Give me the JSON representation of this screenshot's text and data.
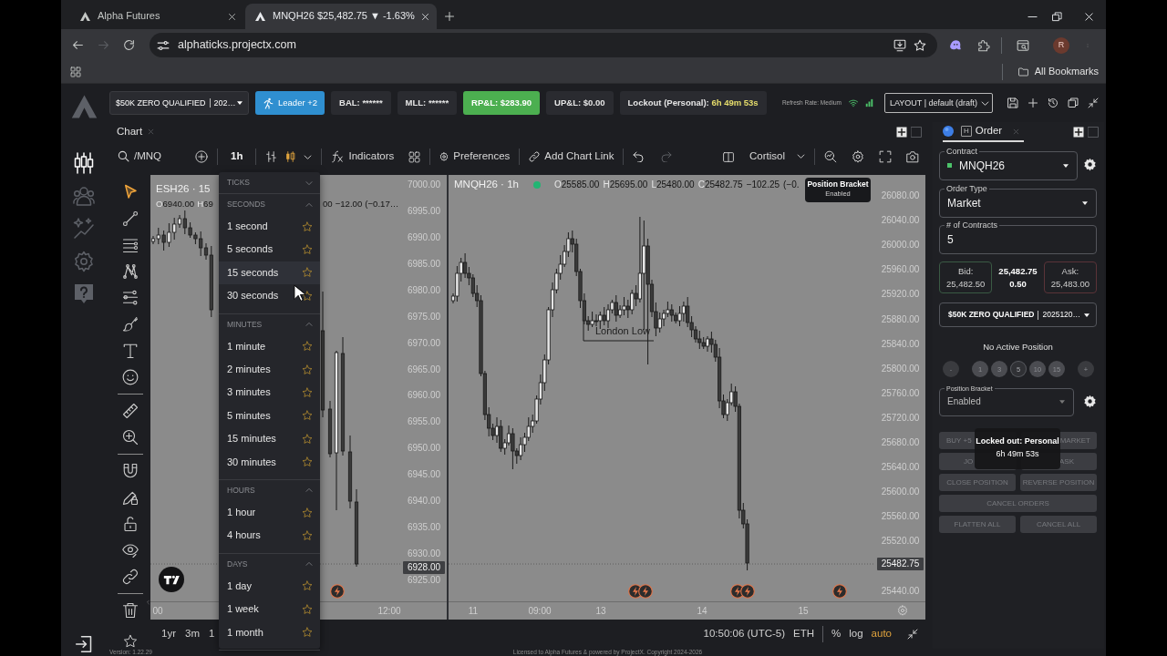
{
  "browser": {
    "tabs": [
      {
        "title": "Alpha Futures",
        "selected": false
      },
      {
        "title": "MNQH26 $25,482.75 ▼ -1.63%",
        "selected": true
      }
    ],
    "url": "alphaticks.projectx.com",
    "profile_initial": "R",
    "bookmarks_folder": "All Bookmarks"
  },
  "header": {
    "account": {
      "name": "$50K ZERO QUALIFIED",
      "number": "202…"
    },
    "leader_button": "Leader +2",
    "stats": [
      {
        "text": "BAL:",
        "value": "******",
        "kind": "plain"
      },
      {
        "text": "MLL:",
        "value": "******",
        "kind": "plain"
      },
      {
        "text": "RP&L:",
        "value": "$283.90",
        "kind": "positive"
      },
      {
        "text": "UP&L:",
        "value": "$0.00",
        "kind": "plain"
      },
      {
        "text": "Lockout (Personal):",
        "value": "6h 49m 53s",
        "kind": "warning"
      }
    ],
    "refresh_rate": "Refresh Rate: Medium",
    "layout": "LAYOUT | default (draft)"
  },
  "nav_rail": [
    {
      "kind": "chart",
      "selected": true
    },
    {
      "kind": "people",
      "selected": false
    },
    {
      "kind": "analytics",
      "selected": false
    },
    {
      "kind": "settings",
      "selected": false
    },
    {
      "kind": "help",
      "selected": false
    }
  ],
  "chart_panel": {
    "tab": "Chart",
    "toolbar": {
      "symbol": "/MNQ",
      "interval": "1h",
      "indicators": "Indicators",
      "preferences": "Preferences",
      "chart_link": "Add Chart Link",
      "undo_disabled": false,
      "redo_disabled": true,
      "template": "Cortisol"
    },
    "drawing_tools": [
      [
        {
          "kind": "cursor",
          "selected": true
        },
        {
          "kind": "trend-line",
          "selected": false
        },
        {
          "kind": "horizontal-lines",
          "selected": false
        },
        {
          "kind": "pattern",
          "selected": false
        },
        {
          "kind": "channel",
          "selected": false
        },
        {
          "kind": "brush",
          "selected": false
        },
        {
          "kind": "text",
          "selected": false
        },
        {
          "kind": "emoji",
          "selected": false
        }
      ],
      [
        {
          "kind": "ruler",
          "selected": false
        },
        {
          "kind": "zoom",
          "selected": false
        }
      ],
      [
        {
          "kind": "magnet",
          "selected": false
        },
        {
          "kind": "lock-drawing",
          "selected": false
        },
        {
          "kind": "lock",
          "selected": false
        },
        {
          "kind": "eye",
          "selected": false
        },
        {
          "kind": "link",
          "selected": false
        }
      ],
      [
        {
          "kind": "trash",
          "selected": false
        }
      ]
    ],
    "interval_menu": {
      "sections": [
        {
          "title": "TICKS",
          "expanded": false
        },
        {
          "title": "SECONDS",
          "expanded": true,
          "items": [
            {
              "label": "1 second",
              "hovered": false,
              "favorite": false
            },
            {
              "label": "5 seconds",
              "hovered": false,
              "favorite": false
            },
            {
              "label": "15 seconds",
              "hovered": true,
              "favorite": false
            },
            {
              "label": "30 seconds",
              "hovered": false,
              "favorite": false
            }
          ]
        },
        {
          "title": "MINUTES",
          "expanded": true,
          "items": [
            {
              "label": "1 minute",
              "hovered": false,
              "favorite": false
            },
            {
              "label": "2 minutes",
              "hovered": false,
              "favorite": false
            },
            {
              "label": "3 minutes",
              "hovered": false,
              "favorite": false
            },
            {
              "label": "5 minutes",
              "hovered": false,
              "favorite": false
            },
            {
              "label": "15 minutes",
              "hovered": false,
              "favorite": false
            },
            {
              "label": "30 minutes",
              "hovered": false,
              "favorite": false
            }
          ]
        },
        {
          "title": "HOURS",
          "expanded": true,
          "items": [
            {
              "label": "1 hour",
              "hovered": false,
              "favorite": false
            },
            {
              "label": "4 hours",
              "hovered": false,
              "favorite": false
            }
          ]
        },
        {
          "title": "DAYS",
          "expanded": true,
          "items": [
            {
              "label": "1 day",
              "hovered": false,
              "favorite": false
            },
            {
              "label": "1 week",
              "hovered": false,
              "favorite": false
            },
            {
              "label": "1 month",
              "hovered": false,
              "favorite": false
            }
          ]
        }
      ]
    },
    "charts": [
      {
        "symbol": "ESH26 · 15",
        "legend": [
          {
            "label": "O",
            "value": "6940.00"
          },
          {
            "label": "H",
            "value": "69"
          }
        ],
        "legend_tail": [
          "00",
          "−12.00",
          "(−0.17…"
        ],
        "price_labels": [
          "7000.00",
          "6995.00",
          "6990.00",
          "6985.00",
          "6980.00",
          "6975.00",
          "6970.00",
          "6965.00",
          "6960.00",
          "6955.00",
          "6950.00",
          "6945.00",
          "6940.00",
          "6935.00",
          "6930.00",
          "6925.00"
        ],
        "last_price": "6928.00",
        "time_labels": [
          "00",
          "12:00"
        ]
      },
      {
        "symbol": "MNQH26 · 1h",
        "legend": [
          {
            "label": "O",
            "value": "25585.00"
          },
          {
            "label": "H",
            "value": "25695.00"
          },
          {
            "label": "L",
            "value": "25480.00"
          },
          {
            "label": "C",
            "value": "25482.75"
          }
        ],
        "legend_tail": [
          "−102.25",
          "(−0."
        ],
        "price_labels": [
          "26080.00",
          "26040.00",
          "26000.00",
          "25960.00",
          "25920.00",
          "25880.00",
          "25840.00",
          "25800.00",
          "25760.00",
          "25720.00",
          "25680.00",
          "25640.00",
          "25600.00",
          "25560.00",
          "25520.00",
          "25440.00"
        ],
        "last_price": "25482.75",
        "time_labels": [
          "11",
          "09:00",
          "13",
          "14",
          "15"
        ],
        "annotation": "London Low",
        "tooltip": {
          "title": "Position Bracket",
          "text": "Enabled"
        }
      }
    ],
    "bottom_bar": {
      "ranges": [
        "1yr",
        "3m",
        "1"
      ],
      "clock": "10:50:06 (UTC-5)",
      "session": "ETH",
      "scale_options": [
        {
          "label": "%",
          "on": false
        },
        {
          "label": "log",
          "on": false
        },
        {
          "label": "auto",
          "on": true
        }
      ]
    }
  },
  "order_panel": {
    "tab": "Order",
    "tab_badge": "H",
    "contract": {
      "label": "Contract",
      "value": "MNQH26"
    },
    "order_type": {
      "label": "Order Type",
      "value": "Market"
    },
    "quantity": {
      "label": "# of Contracts",
      "value": "5"
    },
    "quote": {
      "bid_label": "Bid:",
      "bid": "25,482.50",
      "last": "25,482.75",
      "spread": "0.50",
      "ask_label": "Ask:",
      "ask": "25,483.00"
    },
    "account": {
      "name": "$50K ZERO QUALIFIED",
      "number": "2025120…"
    },
    "position": "No Active Position",
    "presets": [
      {
        "label": "-",
        "kind": "step",
        "selected": false
      },
      {
        "label": "1",
        "kind": "preset",
        "selected": false
      },
      {
        "label": "3",
        "kind": "preset",
        "selected": false
      },
      {
        "label": "5",
        "kind": "preset",
        "selected": true
      },
      {
        "label": "10",
        "kind": "preset",
        "selected": false
      },
      {
        "label": "15",
        "kind": "preset",
        "selected": false
      },
      {
        "label": "+",
        "kind": "step",
        "selected": false
      }
    ],
    "bracket": {
      "label": "Position Bracket",
      "value": "Enabled"
    },
    "actions": [
      [
        {
          "label": "BUY +5",
          "disabled": true
        },
        {
          "label": "MARKET",
          "disabled": true
        }
      ],
      [
        {
          "label": "JO",
          "disabled": true
        },
        {
          "label": "ASK",
          "disabled": true
        }
      ],
      [
        {
          "label": "CLOSE POSITION",
          "disabled": true
        },
        {
          "label": "REVERSE POSITION",
          "disabled": true
        }
      ],
      [
        {
          "label": "CANCEL ORDERS",
          "disabled": true
        }
      ],
      [
        {
          "label": "FLATTEN ALL",
          "disabled": true
        },
        {
          "label": "CANCEL ALL",
          "disabled": true
        }
      ]
    ],
    "lockout": {
      "title": "Locked out: Personal",
      "time": "6h 49m 53s"
    }
  },
  "footer": {
    "version": "Version: 1.22.29",
    "license": "Licensed to Alpha Futures & powered by ProjectX. Copyright 2024-2026"
  }
}
